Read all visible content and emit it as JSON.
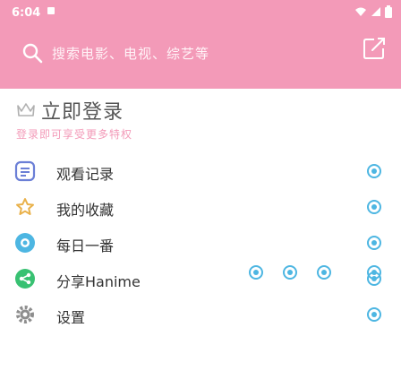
{
  "status": {
    "time": "6:04"
  },
  "search": {
    "placeholder": "搜索电影、电视、综艺等"
  },
  "login": {
    "title": "立即登录",
    "subtitle": "登录即可享受更多特权"
  },
  "menu": [
    {
      "label": "观看记录",
      "icon": "history-icon"
    },
    {
      "label": "我的收藏",
      "icon": "favorite-icon"
    },
    {
      "label": "每日一番",
      "icon": "daily-icon"
    },
    {
      "label": "分享Hanime",
      "icon": "share-icon"
    },
    {
      "label": "设置",
      "icon": "settings-icon"
    }
  ],
  "colors": {
    "accent": "#f39ab8",
    "radio": "#4db6e2"
  }
}
